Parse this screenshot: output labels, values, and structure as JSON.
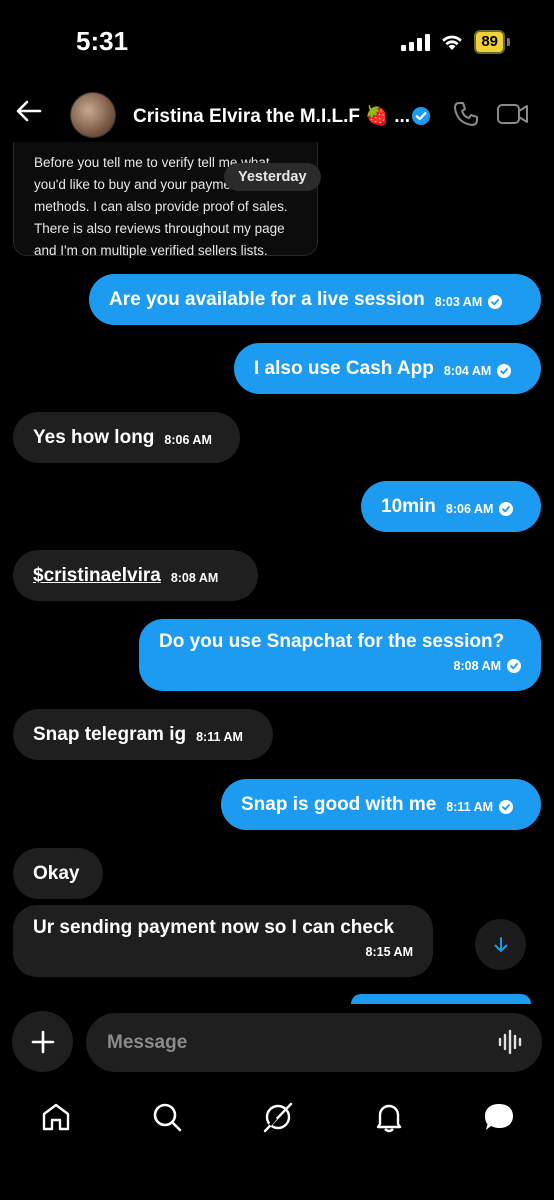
{
  "status_bar": {
    "time": "5:31",
    "battery": "89"
  },
  "header": {
    "contact_name": "Cristina Elvira the M.I.L.F 🍓 ..."
  },
  "older_message": {
    "lines": [
      "Before you tell me to verify tell me what",
      "you'd like to buy and your payme",
      "methods. I can also provide proof of sales.",
      "There is also reviews throughout my page",
      "and I'm on multiple verified sellers lists."
    ]
  },
  "date_separator": "Yesterday",
  "messages": [
    {
      "text": "Are you available for a live session",
      "time": "8:03 AM",
      "direction": "out"
    },
    {
      "text": "I also use Cash App",
      "time": "8:04 AM",
      "direction": "out"
    },
    {
      "text": "Yes how long",
      "time": "8:06 AM",
      "direction": "in"
    },
    {
      "text": "10min",
      "time": "8:06 AM",
      "direction": "out"
    },
    {
      "text": "$cristinaelvira",
      "time": "8:08 AM",
      "direction": "in"
    },
    {
      "text": "Do you use Snapchat for the session?",
      "time": "8:08 AM",
      "direction": "out"
    },
    {
      "text": "Snap telegram ig",
      "time": "8:11 AM",
      "direction": "in"
    },
    {
      "text": "Snap is good with me",
      "time": "8:11 AM",
      "direction": "out"
    },
    {
      "text": "Okay",
      "time": "",
      "direction": "in"
    },
    {
      "text": "Ur sending payment now so I can check",
      "time": "8:15 AM",
      "direction": "in"
    }
  ],
  "composer": {
    "placeholder": "Message"
  },
  "nav": [
    "home-icon",
    "search-icon",
    "grok-icon",
    "notifications-icon",
    "messages-icon"
  ],
  "colors": {
    "accent": "#1d9bf0",
    "incoming_bubble": "#1f1f1f",
    "battery": "#f1d13b"
  }
}
